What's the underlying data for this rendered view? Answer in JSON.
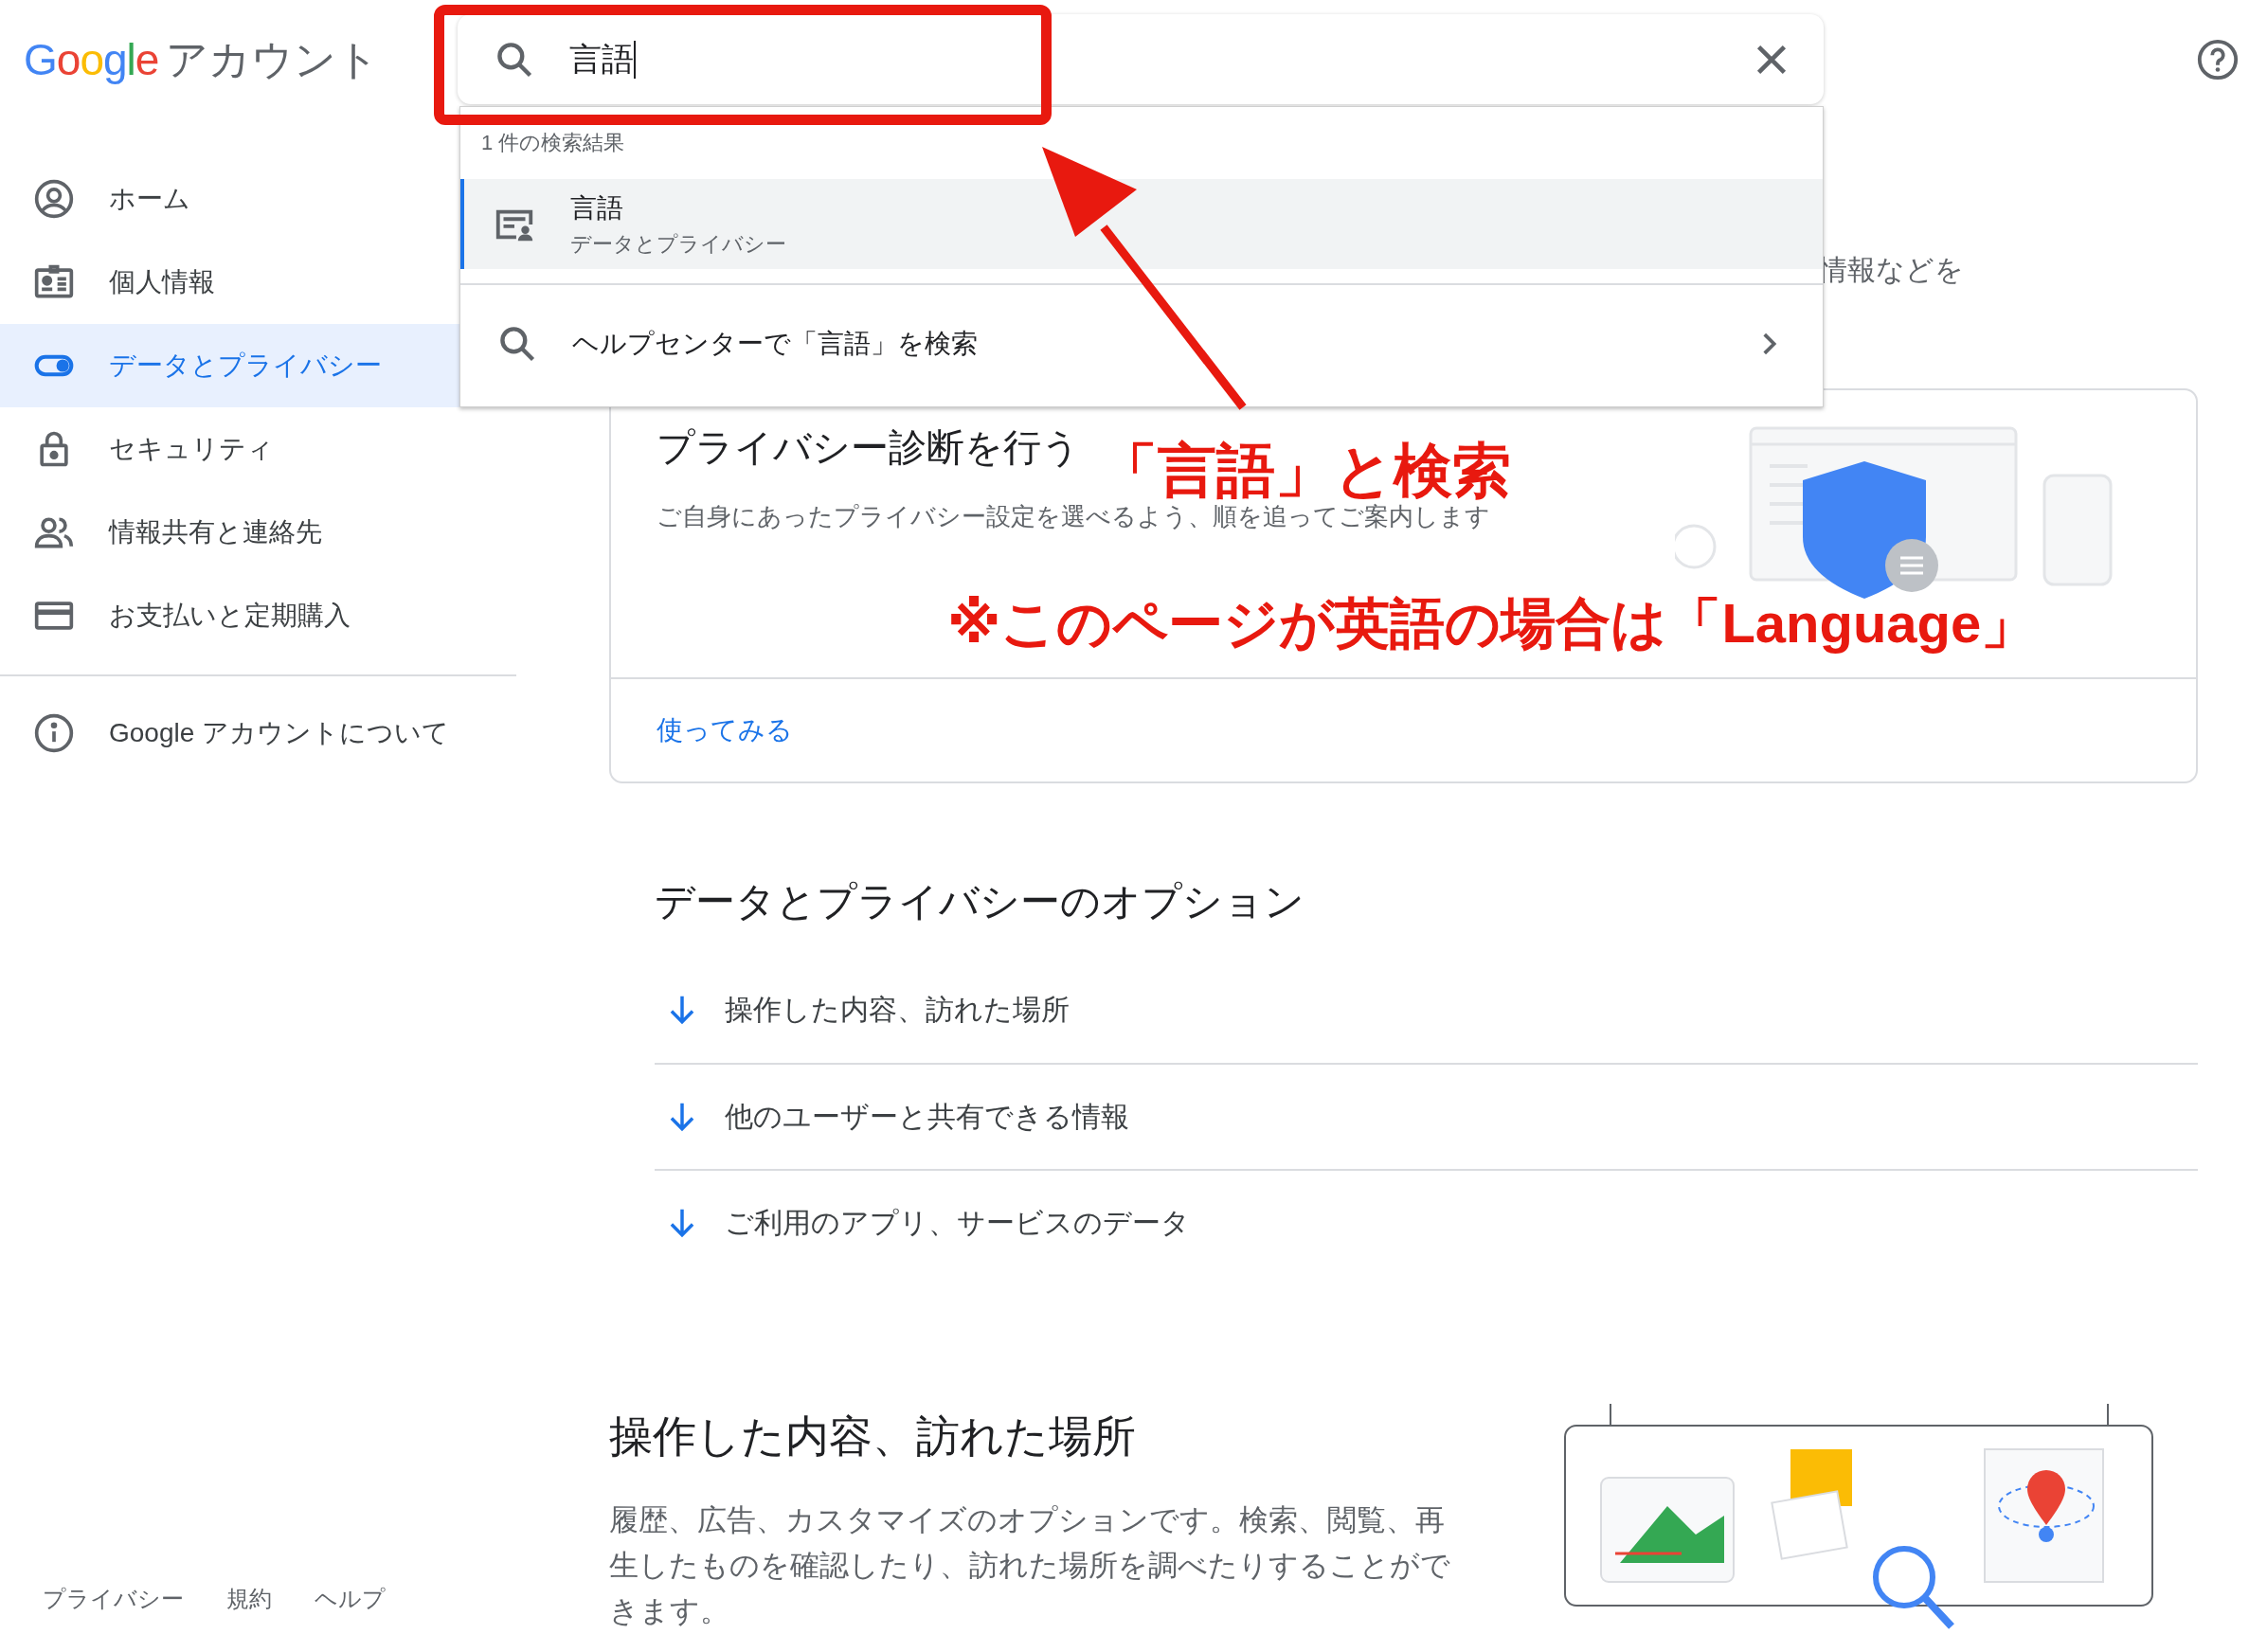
{
  "header": {
    "logo": "Google",
    "title": "アカウント"
  },
  "search": {
    "value": "言語",
    "result_count": "1 件の検索結果",
    "results": [
      {
        "title": "言語",
        "subtitle": "データとプライバシー",
        "selected": true
      }
    ],
    "help_search": "ヘルプセンターで「言語」を検索"
  },
  "sidebar": {
    "items": [
      {
        "label": "ホーム",
        "selected": false
      },
      {
        "label": "個人情報",
        "selected": false
      },
      {
        "label": "データとプライバシー",
        "selected": true
      },
      {
        "label": "セキュリティ",
        "selected": false
      },
      {
        "label": "情報共有と連絡先",
        "selected": false
      },
      {
        "label": "お支払いと定期購入",
        "selected": false
      }
    ],
    "about": "Google アカウントについて"
  },
  "footer": [
    "プライバシー",
    "規約",
    "ヘルプ"
  ],
  "intro_fragment": "情報などを",
  "card": {
    "title": "プライバシー診断を行う",
    "description": "ご自身にあったプライバシー設定を選べるよう、順を追ってご案内します",
    "action": "使ってみる"
  },
  "options": {
    "title": "データとプライバシーのオプション",
    "items": [
      "操作した内容、訪れた場所",
      "他のユーザーと共有できる情報",
      "ご利用のアプリ、サービスのデータ"
    ]
  },
  "section": {
    "title": "操作した内容、訪れた場所",
    "description": "履歴、広告、カスタマイズのオプションです。検索、閲覧、再生したものを確認したり、訪れた場所を調べたりすることができます。"
  },
  "annotation": {
    "lines": [
      "「言語」と検索",
      "※このページが英語の場合は「Language」"
    ]
  }
}
